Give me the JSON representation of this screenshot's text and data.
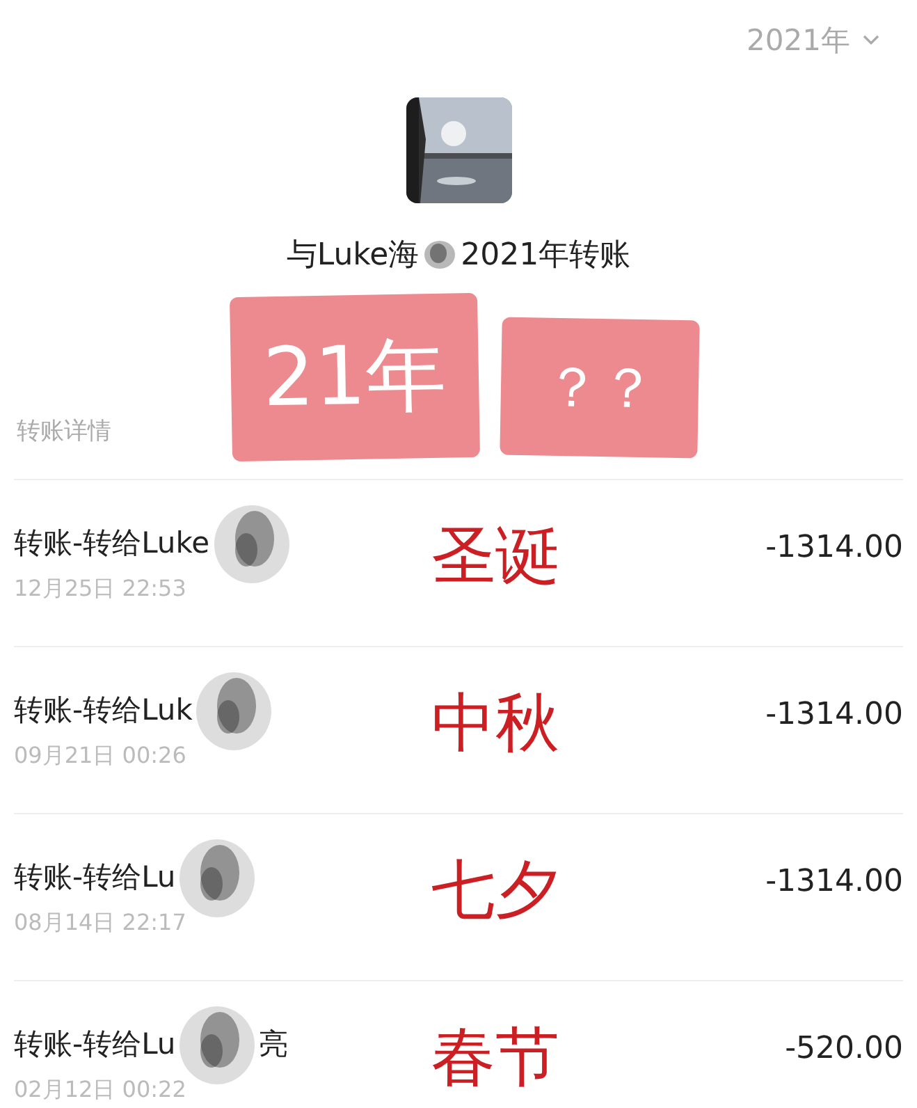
{
  "year_filter": {
    "label": "2021年"
  },
  "header": {
    "title_before": "与Luke海",
    "title_after": "2021年转账"
  },
  "stickers": [
    {
      "text": "21年"
    },
    {
      "text": "？？"
    }
  ],
  "section_label": "转账详情",
  "transactions": [
    {
      "title": "转账-转给Luke",
      "date": "12月25日  22:53",
      "amount": "-1314.00",
      "annotation": "圣诞"
    },
    {
      "title": "转账-转给Luk",
      "date": "09月21日  00:26",
      "amount": "-1314.00",
      "annotation": "中秋"
    },
    {
      "title": "转账-转给Lu",
      "date": "08月14日  22:17",
      "amount": "-1314.00",
      "annotation": "七夕"
    },
    {
      "title": "转账-转给Lu",
      "title_suffix": "亮",
      "date": "02月12日  00:22",
      "amount": "-520.00",
      "annotation": "春节"
    }
  ]
}
